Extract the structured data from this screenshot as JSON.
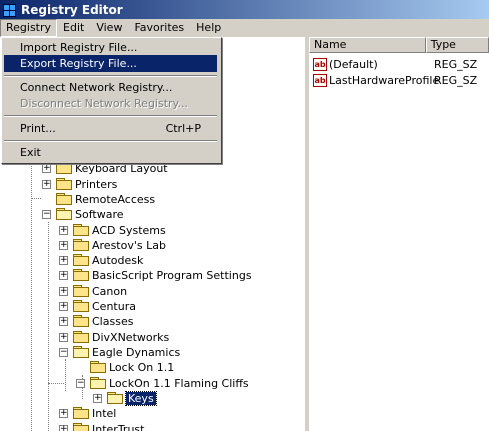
{
  "window": {
    "title": "Registry Editor"
  },
  "menubar": {
    "items": [
      "Registry",
      "Edit",
      "View",
      "Favorites",
      "Help"
    ]
  },
  "registry_menu": {
    "import": "Import Registry File...",
    "export": "Export Registry File...",
    "connect": "Connect Network Registry...",
    "disconnect": "Disconnect Network Registry...",
    "print": "Print...",
    "print_shortcut": "Ctrl+P",
    "exit": "Exit"
  },
  "tree": {
    "nodes": [
      "Keyboard Layout",
      "Printers",
      "RemoteAccess",
      "Software",
      "ACD Systems",
      "Arestov's Lab",
      "Autodesk",
      "BasicScript Program Settings",
      "Canon",
      "Centura",
      "Classes",
      "DivXNetworks",
      "Eagle Dynamics",
      "Lock On 1.1",
      "LockOn 1.1 Flaming Cliffs",
      "Keys",
      "Intel",
      "InterTrust"
    ]
  },
  "list": {
    "columns": [
      "Name",
      "Type"
    ],
    "rows": [
      {
        "name": "(Default)",
        "type": "REG_SZ",
        "icon": "string-value-icon"
      },
      {
        "name": "LastHardwareProfile",
        "type": "REG_SZ",
        "icon": "string-value-icon"
      }
    ]
  },
  "colors": {
    "title_start": "#0a246a",
    "title_end": "#a6caf0",
    "selection": "#0a246a",
    "folder": "#ffe48a"
  }
}
